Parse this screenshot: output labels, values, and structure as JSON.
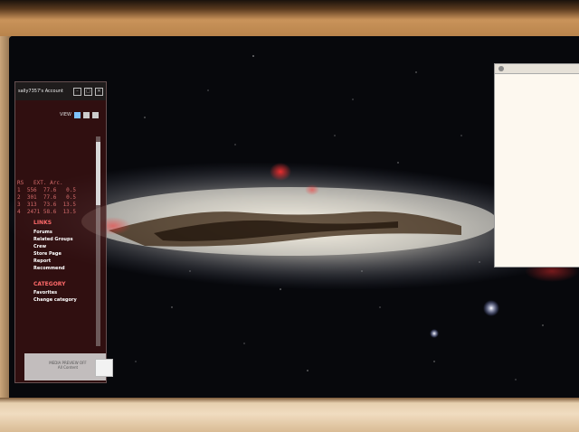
{
  "widget": {
    "account_title": "sally7357's Account",
    "controls": [
      "–",
      "□",
      "✕"
    ],
    "view_label": "VIEW",
    "stats_header": "RS   EXT. Arc.",
    "stats_rows": [
      "1  556  77.6   0.5",
      "2  301  77.6   0.5",
      "3  313  73.6  13.5",
      "4  2471 58.6  13.5"
    ],
    "links_title": "LINKS",
    "links": [
      "Forums",
      "Related Groups",
      "Crew",
      "Store Page",
      "Report",
      "Recommend"
    ],
    "category_title": "CATEGORY",
    "categories": [
      "Favorites",
      "Change category"
    ],
    "footer_text": "MEDIA PREVIEW OFF",
    "footer_subtext": "All Content"
  },
  "colors": {
    "widget_bg": "#3c1212",
    "accent_red": "#ff6a6a",
    "view_active": "#7fc3ff",
    "desktop_bg": "#07080c"
  }
}
